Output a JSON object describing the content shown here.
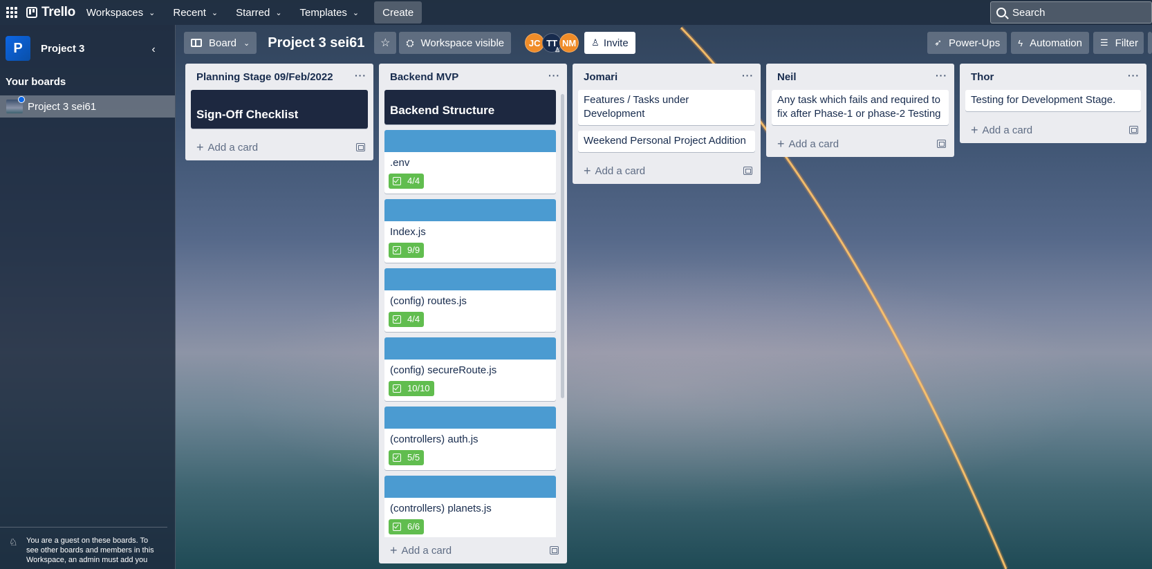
{
  "topnav": {
    "brand": "Trello",
    "items": [
      {
        "label": "Workspaces"
      },
      {
        "label": "Recent"
      },
      {
        "label": "Starred"
      },
      {
        "label": "Templates"
      }
    ],
    "create_label": "Create",
    "search_placeholder": "Search"
  },
  "sidebar": {
    "workspace_initial": "P",
    "workspace_name": "Project 3",
    "your_boards_label": "Your boards",
    "boards": [
      {
        "label": "Project 3 sei61"
      }
    ],
    "guest_note": "You are a guest on these boards. To see other boards and members in this Workspace, an admin must add you"
  },
  "board": {
    "view_label": "Board",
    "title": "Project 3 sei61",
    "visibility_label": "Workspace visible",
    "members": [
      "JC",
      "TT",
      "NM"
    ],
    "invite_label": "Invite",
    "powerups_label": "Power-Ups",
    "automation_label": "Automation",
    "filter_label": "Filter"
  },
  "lists": [
    {
      "title": "Planning Stage 09/Feb/2022",
      "cards": [
        {
          "title": "Sign-Off Checklist"
        }
      ],
      "add_label": "Add a card"
    },
    {
      "title": "Backend MVP",
      "cards": [
        {
          "title": "Backend Structure"
        },
        {
          "title": ".env",
          "checklist": "4/4"
        },
        {
          "title": "Index.js",
          "checklist": "9/9"
        },
        {
          "title": "(config) routes.js",
          "checklist": "4/4"
        },
        {
          "title": "(config) secureRoute.js",
          "checklist": "10/10"
        },
        {
          "title": "(controllers) auth.js",
          "checklist": "5/5"
        },
        {
          "title": "(controllers) planets.js",
          "checklist": "6/6"
        }
      ],
      "add_label": "Add a card"
    },
    {
      "title": "Jomari",
      "cards": [
        {
          "title": "Features / Tasks under Development"
        },
        {
          "title": "Weekend Personal Project Addition"
        }
      ],
      "add_label": "Add a card"
    },
    {
      "title": "Neil",
      "cards": [
        {
          "title": "Any task which fails and required to fix after Phase-1 or phase-2 Testing"
        }
      ],
      "add_label": "Add a card"
    },
    {
      "title": "Thor",
      "cards": [
        {
          "title": "Testing for Development Stage."
        }
      ],
      "add_label": "Add a card"
    }
  ],
  "colors": {
    "card_cover": "#4b9bd1",
    "checklist_done": "#61bd4f",
    "dark_card": "#1d2840",
    "avatar_orange": "#f08c28"
  }
}
